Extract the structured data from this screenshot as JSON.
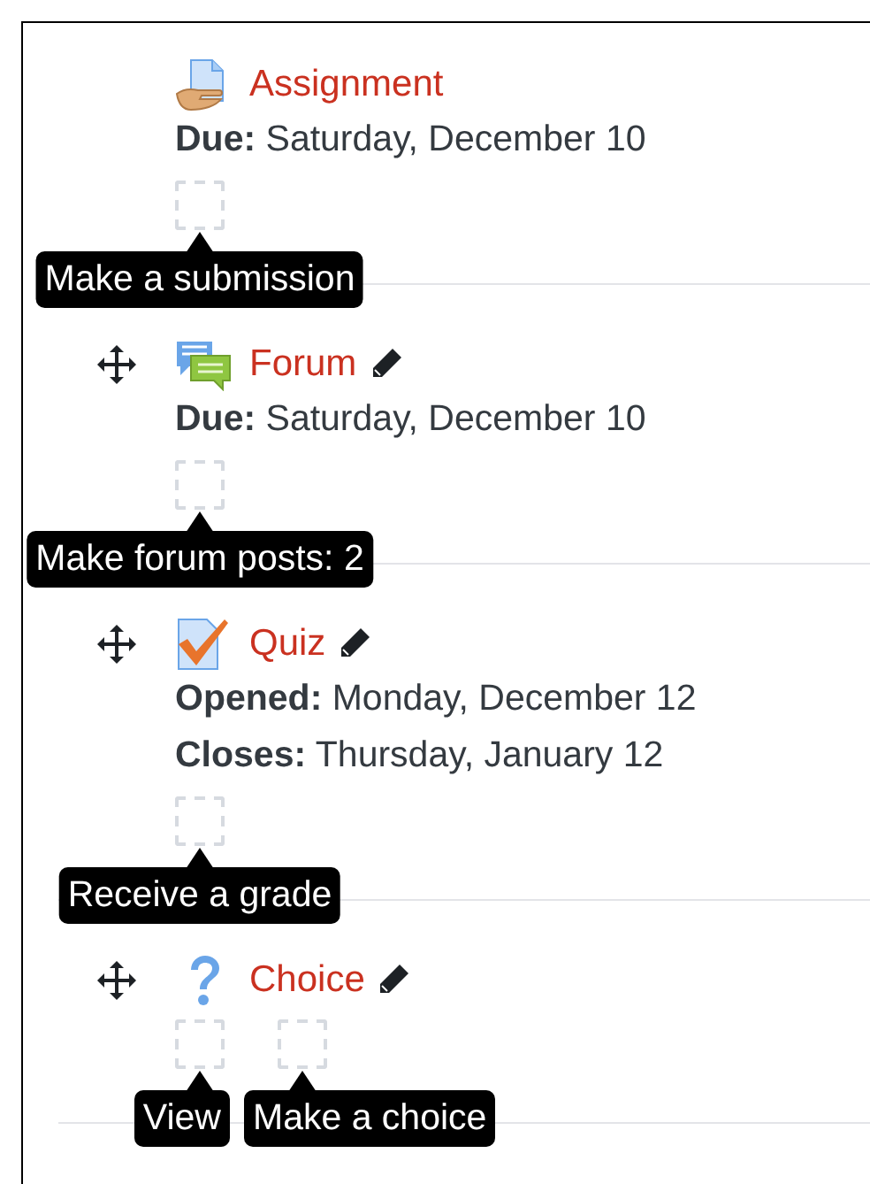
{
  "activities": [
    {
      "kind": "assignment",
      "name": "Assignment",
      "movable": false,
      "editable": false,
      "dates": [
        {
          "label": "Due:",
          "value": "Saturday, December 10"
        }
      ],
      "conditions": [
        {
          "tooltip": "Make a submission",
          "checked": false
        }
      ]
    },
    {
      "kind": "forum",
      "name": "Forum",
      "movable": true,
      "editable": true,
      "dates": [
        {
          "label": "Due:",
          "value": "Saturday, December 10"
        }
      ],
      "conditions": [
        {
          "tooltip": "Make forum posts: 2",
          "checked": false
        }
      ]
    },
    {
      "kind": "quiz",
      "name": "Quiz",
      "movable": true,
      "editable": true,
      "dates": [
        {
          "label": "Opened:",
          "value": "Monday, December 12"
        },
        {
          "label": "Closes:",
          "value": "Thursday, January 12"
        }
      ],
      "conditions": [
        {
          "tooltip": "Receive a grade",
          "checked": false
        }
      ]
    },
    {
      "kind": "choice",
      "name": "Choice",
      "movable": true,
      "editable": true,
      "conditions": [
        {
          "tooltip": "View",
          "checked": false
        },
        {
          "tooltip": "Make a choice",
          "checked": false
        }
      ]
    }
  ]
}
